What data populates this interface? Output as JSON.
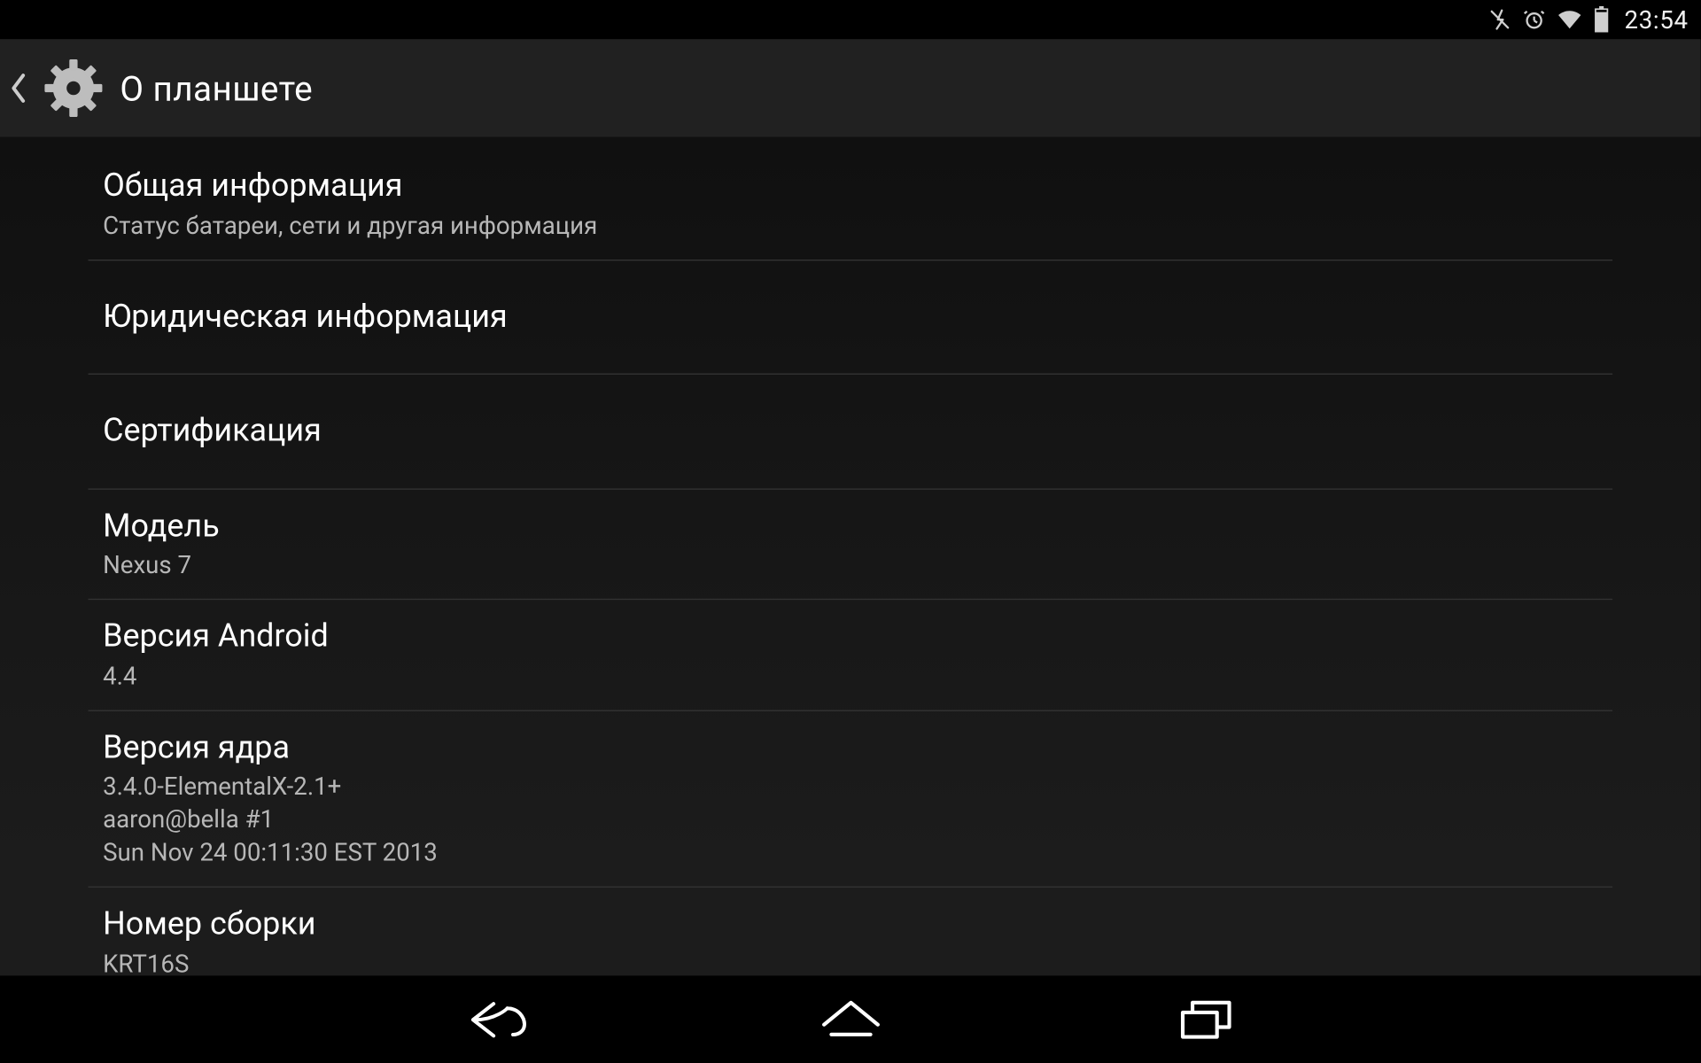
{
  "status": {
    "time": "23:54"
  },
  "actionbar": {
    "title": "О планшете"
  },
  "rows": [
    {
      "title": "Общая информация",
      "sub": "Статус батареи, сети и другая информация"
    },
    {
      "title": "Юридическая информация"
    },
    {
      "title": "Сертификация"
    },
    {
      "title": "Модель",
      "sub": "Nexus 7"
    },
    {
      "title": "Версия Android",
      "sub": "4.4"
    },
    {
      "title": "Версия ядра",
      "sub": "3.4.0-ElementalX-2.1+\naaron@bella #1\nSun Nov 24 00:11:30 EST 2013"
    },
    {
      "title": "Номер сборки",
      "sub": "KRT16S"
    }
  ]
}
